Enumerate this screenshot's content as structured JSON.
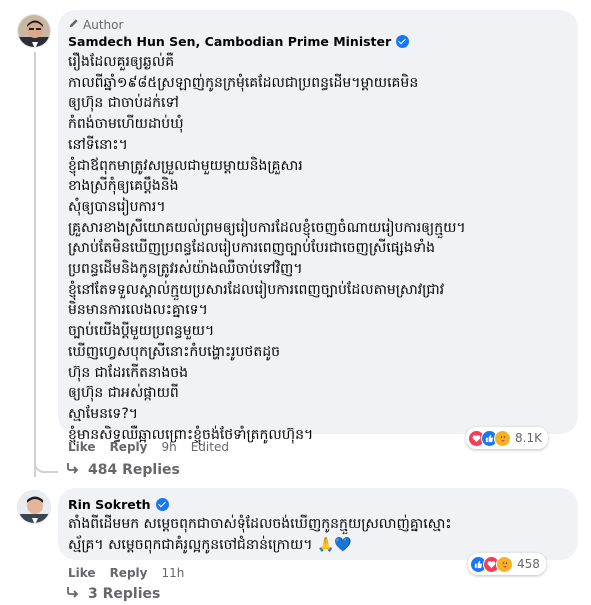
{
  "comment1": {
    "author_badge": "Author",
    "name": "Samdech Hun Sen, Cambodian Prime Minister",
    "lines": [
      "រឿងដែលគួរឲ្យឆ្ងល់គឺ",
      "កាលពីឆ្នាំ១៩៨៥ស្រឡាញ់កូនក្រមុំគេដែលជាប្រពន្ធដើម។ម្តាយគេមិន",
      "ឲ្យហ៊ុន ជាចាប់ដក់ទៅ",
      "កំពង់ចាមហើយដាប់ឃុំ",
      "នៅទីនោះ។",
      "ខ្ញុំជាឪពុកមាត្រូវសម្រួលជាមួយម្តាយនិងគ្រួសារ",
      "ខាងស្រីកុំឲ្យគេប្តឹងនិង",
      "សុំឲ្យបានរៀបការ។",
      "គ្រួសារខាងស្រីយោគយល់ព្រមឲ្យរៀបការដែលខ្ញុំចេញចំណាយរៀបការឲ្យក្មួយ។",
      "ស្រាប់តែមិនឃើញប្រពន្ធដែលរៀបការពេញច្បាប់បែរជាចេញស្រីផ្សេងទាំង",
      "ប្រពន្ធដើមនិងកូនត្រូវរស់យ៉ាងឈឺចាប់ទៅវិញ។",
      "ខ្ញុំនៅតែទទួលស្គាល់ក្មួយប្រសារដែលរៀបការពេញច្បាប់ដែលតាមស្រាវជ្រាវ",
      "មិនមានការលេងលះគ្នាទេ។",
      "ច្បាប់យើងប្តីមួយប្រពន្ធមួយ។",
      "ឃើញហ្វេសបុកស្រីនោះកំបង្ហោះរូបថតដូច",
      "ហ៊ុន ជាដែរកើតនាងចង",
      "ឲ្យហ៊ុន ជាអស់ផ្កាយពី",
      "ស្មាមែនទេ?។",
      "ខ្ញុំមានសិទ្ធឈឺឆ្អាលព្រោះខ្ញុំចង់ថែទាំត្រកូលហ៊ុន។"
    ],
    "like_label": "Like",
    "reply_label": "Reply",
    "time": "9h",
    "edited_label": "Edited",
    "reaction_count": "8.1K",
    "replies_label": "484 Replies"
  },
  "comment2": {
    "name": "Rin Sokreth",
    "lines": [
      "តាំងពីដើមមក សម្តេចពុកជាចាស់ទុំដែលចង់ឃើញកូនក្មួយស្រលាញ់គ្នាស្មោះ",
      "ស្ម័គ្រ។ សម្តេចពុកជាគំរូល្អកូនចៅជំនាន់ក្រោយ។ 🙏💙"
    ],
    "like_label": "Like",
    "reply_label": "Reply",
    "time": "11h",
    "reaction_count": "458",
    "replies_label": "3 Replies"
  },
  "colors": {
    "bubble": "#f0f2f5",
    "verified": "#1877f2",
    "muted": "#65676b",
    "like": "#1877f2",
    "love": "#f33e58",
    "care": "#f7b125"
  },
  "icons": {
    "author": "pen-icon",
    "verified": "verified-check-icon",
    "reply_arrow": "reply-arrow-icon",
    "reactions": [
      "love-icon",
      "like-icon",
      "care-icon"
    ]
  }
}
